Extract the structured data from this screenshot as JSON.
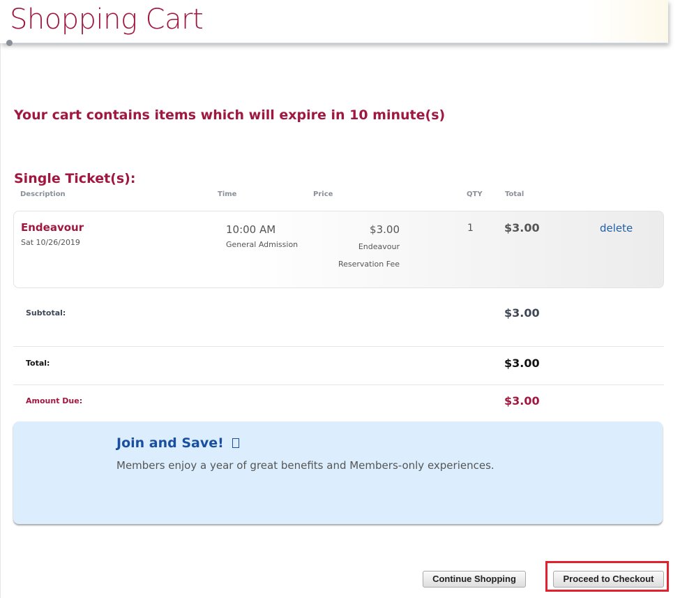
{
  "page": {
    "title": "Shopping Cart",
    "expire_message": "Your cart contains items which will expire in 10 minute(s)",
    "section_title": "Single Ticket(s):"
  },
  "columns": {
    "description": "Description",
    "time": "Time",
    "price": "Price",
    "qty": "QTY",
    "total": "Total"
  },
  "cart_item": {
    "name": "Endeavour",
    "date": "Sat 10/26/2019",
    "time": "10:00 AM",
    "admission_type": "General Admission",
    "price": "$3.00",
    "fee_line1": "Endeavour",
    "fee_line2": "Reservation Fee",
    "qty": "1",
    "total": "$3.00",
    "delete_label": "delete"
  },
  "summary": {
    "subtotal_label": "Subtotal:",
    "subtotal_value": "$3.00",
    "total_label": "Total:",
    "total_value": "$3.00",
    "amount_due_label": "Amount Due:",
    "amount_due_value": "$3.00"
  },
  "promo": {
    "title": "Join and Save!",
    "icon": "external-link-icon",
    "text": "Members enjoy a year of great benefits and Members-only experiences."
  },
  "actions": {
    "continue_label": "Continue Shopping",
    "checkout_label": "Proceed to Checkout"
  },
  "colors": {
    "brand": "#a0173f",
    "link": "#1f5fa8",
    "promo_bg": "#dceefd",
    "highlight": "#e2202e"
  }
}
